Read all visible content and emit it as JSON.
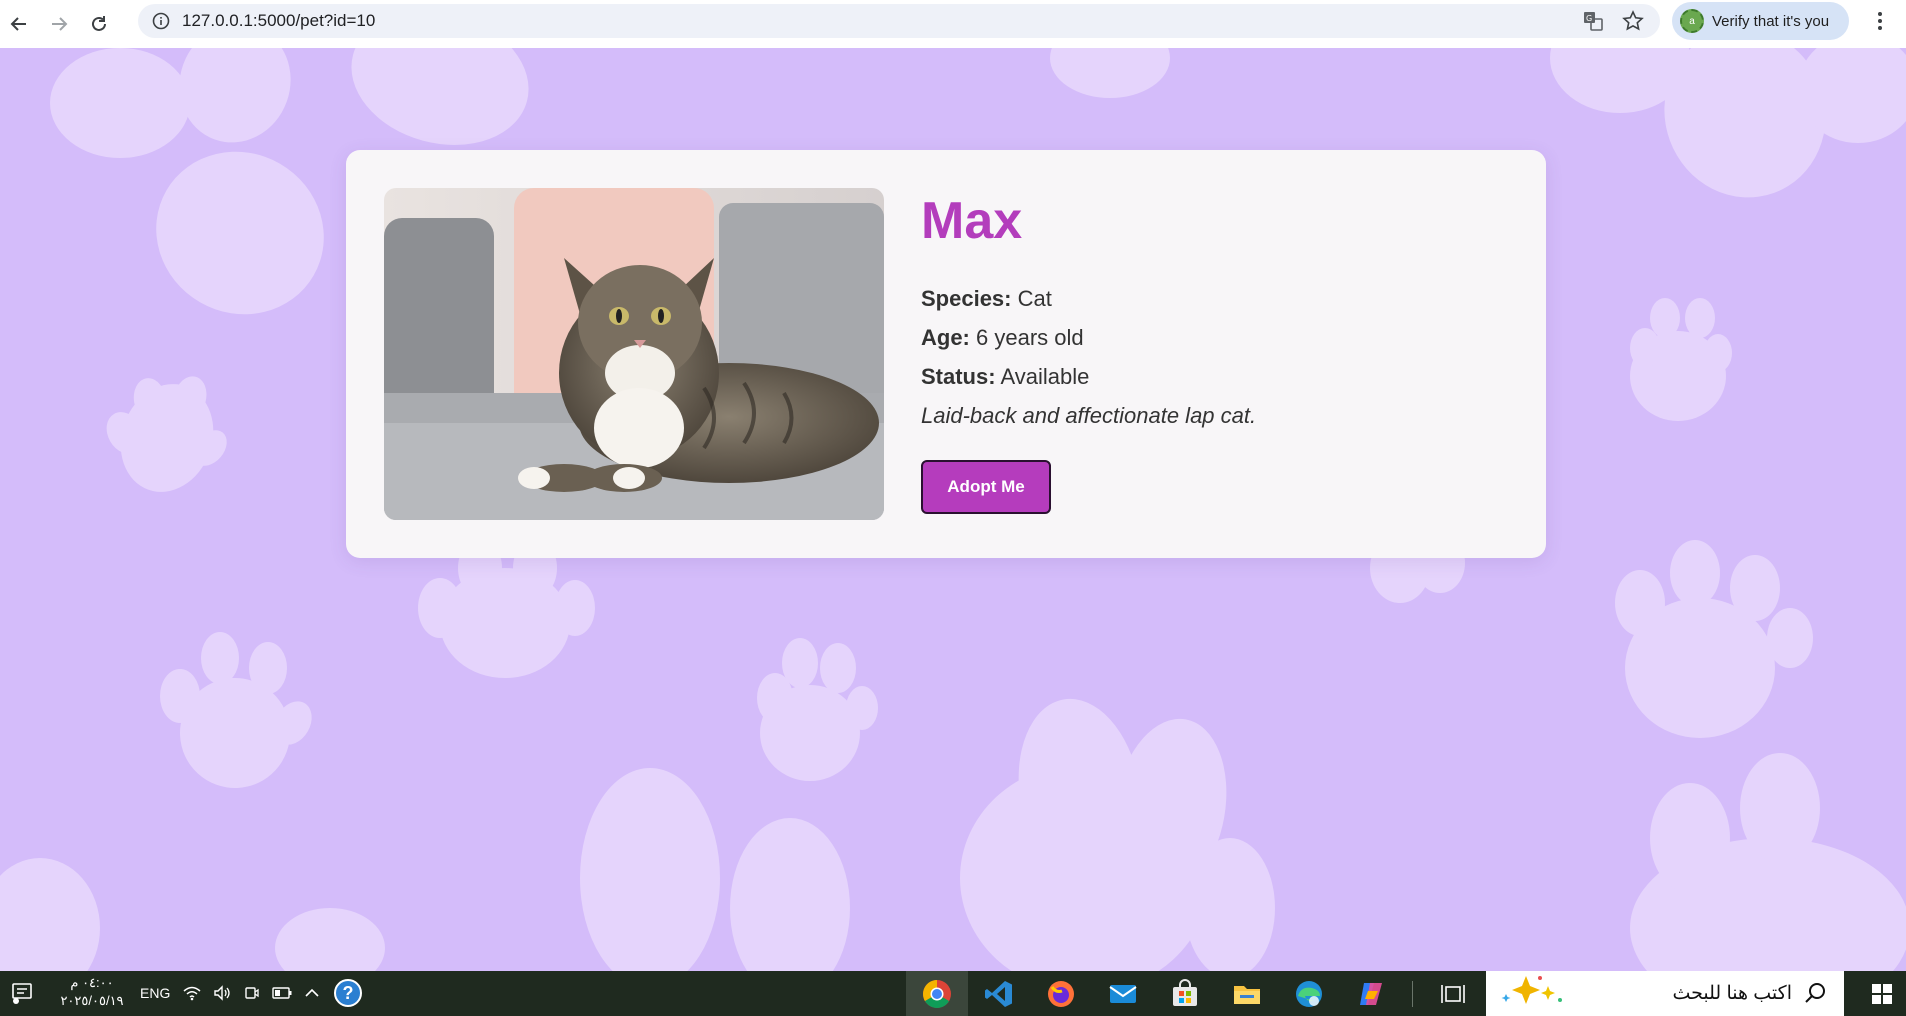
{
  "browser": {
    "url": "127.0.0.1:5000/pet?id=10",
    "verify_label": "Verify that it's you",
    "avatar_letter": "a"
  },
  "pet": {
    "name": "Max",
    "species_label": "Species:",
    "species": "Cat",
    "age_label": "Age:",
    "age": "6 years old",
    "status_label": "Status:",
    "status": "Available",
    "description": "Laid-back and affectionate lap cat.",
    "adopt_button": "Adopt Me"
  },
  "taskbar": {
    "time": "٠٤:٠٠ م",
    "date": "٢٠٢٥/٠٥/١٩",
    "language": "ENG",
    "search_placeholder": "اكتب هنا للبحث",
    "apps": [
      "chrome-icon",
      "vscode-icon",
      "firefox-icon",
      "mail-icon",
      "store-icon",
      "file-explorer-icon",
      "edge-icon",
      "copilot-icon",
      "task-view-icon"
    ]
  },
  "colors": {
    "background": "#d4bcfa",
    "paw": "#e5d4fc",
    "accent": "#b33dbc",
    "card": "#f8f6f8"
  }
}
